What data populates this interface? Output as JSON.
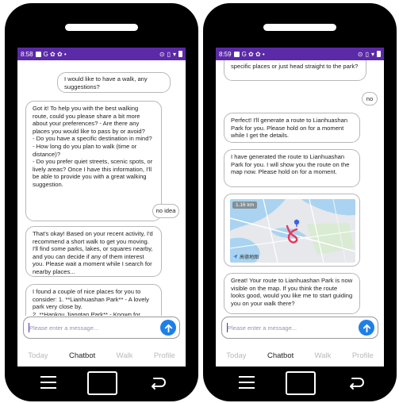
{
  "phones": [
    {
      "status": {
        "time": "8:58",
        "indicators": "G ✿ ✿ •"
      },
      "messages": [
        {
          "role": "user",
          "text": "I would like to have a walk, any suggestions?"
        },
        {
          "role": "bot",
          "text": "Got it! To help you with the best walking route, could you please share a bit more about your preferences? - Are there any places you would like to pass by or avoid?\n- Do you have a specific destination in mind?\n- How long do you plan to walk (time or distance)?\n- Do you prefer quiet streets, scenic spots, or lively areas? Once I have this information, I'll be able to provide you with a great walking suggestion."
        },
        {
          "role": "user",
          "text": "no idea"
        },
        {
          "role": "bot",
          "text": "That's okay! Based on your recent activity, I'd recommend a short walk to get you moving. I'll find some parks, lakes, or squares nearby, and you can decide if any of them interest you. Please wait a moment while I search for nearby places..."
        },
        {
          "role": "bot",
          "text": "I found a couple of nice places for you to consider: 1. **Lianhuashan Park** - A lovely park very close by.\n2. **Hankou Jiangtan Park** - Known for"
        }
      ],
      "input_placeholder": "Please enter a message...",
      "tabs": [
        "Today",
        "Chatbot",
        "Walk",
        "Profile"
      ],
      "active_tab": "Chatbot"
    },
    {
      "status": {
        "time": "8:59",
        "indicators": "G ✿ ✿ •"
      },
      "messages": [
        {
          "role": "bot",
          "text": "specific places or just head straight to the park?"
        },
        {
          "role": "user",
          "text": "no"
        },
        {
          "role": "bot",
          "text": "Perfect! I'll generate a route to Lianhuashan Park for you. Please hold on for a moment while I get the details."
        },
        {
          "role": "bot",
          "text": "I have generated the route to Lianhuashan Park for you. I will show you the route on the map now. Please hold on for a moment."
        },
        {
          "role": "bot",
          "text": "Great! Your route to Lianhuashan Park is now visible on the map. If you think the route looks good, would you like me to start guiding you on your walk there?"
        }
      ],
      "map": {
        "distance_badge": "1.16 km",
        "brand": "高德地图"
      },
      "input_placeholder": "Please enter a message...",
      "tabs": [
        "Today",
        "Chatbot",
        "Walk",
        "Profile"
      ],
      "active_tab": "Chatbot"
    }
  ],
  "colors": {
    "status_bar": "#5b2aa7",
    "send_button": "#1e7fe6",
    "route": "#e8375a",
    "water": "#a9d3f0"
  }
}
